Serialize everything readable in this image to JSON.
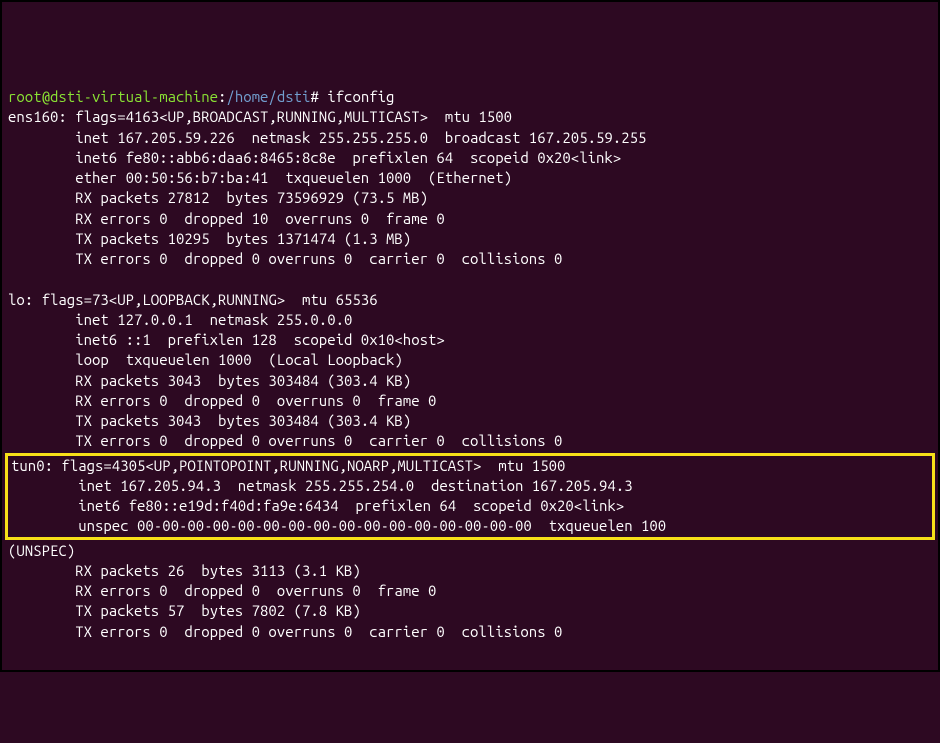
{
  "prompt": {
    "user_host": "root@dsti-virtual-machine",
    "colon": ":",
    "path": "/home/dsti",
    "hash": "#",
    "command": "ifconfig"
  },
  "ens160": {
    "l1": "ens160: flags=4163<UP,BROADCAST,RUNNING,MULTICAST>  mtu 1500",
    "l2": "        inet 167.205.59.226  netmask 255.255.255.0  broadcast 167.205.59.255",
    "l3": "        inet6 fe80::abb6:daa6:8465:8c8e  prefixlen 64  scopeid 0x20<link>",
    "l4": "        ether 00:50:56:b7:ba:41  txqueuelen 1000  (Ethernet)",
    "l5": "        RX packets 27812  bytes 73596929 (73.5 MB)",
    "l6": "        RX errors 0  dropped 10  overruns 0  frame 0",
    "l7": "        TX packets 10295  bytes 1371474 (1.3 MB)",
    "l8": "        TX errors 0  dropped 0 overruns 0  carrier 0  collisions 0"
  },
  "lo": {
    "l1": "lo: flags=73<UP,LOOPBACK,RUNNING>  mtu 65536",
    "l2": "        inet 127.0.0.1  netmask 255.0.0.0",
    "l3": "        inet6 ::1  prefixlen 128  scopeid 0x10<host>",
    "l4": "        loop  txqueuelen 1000  (Local Loopback)",
    "l5": "        RX packets 3043  bytes 303484 (303.4 KB)",
    "l6": "        RX errors 0  dropped 0  overruns 0  frame 0",
    "l7": "        TX packets 3043  bytes 303484 (303.4 KB)",
    "l8": "        TX errors 0  dropped 0 overruns 0  carrier 0  collisions 0"
  },
  "tun0": {
    "l1": "tun0: flags=4305<UP,POINTOPOINT,RUNNING,NOARP,MULTICAST>  mtu 1500",
    "l2": "        inet 167.205.94.3  netmask 255.255.254.0  destination 167.205.94.3",
    "l3": "        inet6 fe80::e19d:f40d:fa9e:6434  prefixlen 64  scopeid 0x20<link>",
    "l4": "        unspec 00-00-00-00-00-00-00-00-00-00-00-00-00-00-00-00  txqueuelen 100",
    "l5": "(UNSPEC)",
    "l6": "        RX packets 26  bytes 3113 (3.1 KB)",
    "l7": "        RX errors 0  dropped 0  overruns 0  frame 0",
    "l8": "        TX packets 57  bytes 7802 (7.8 KB)",
    "l9": "        TX errors 0  dropped 0 overruns 0  carrier 0  collisions 0"
  }
}
